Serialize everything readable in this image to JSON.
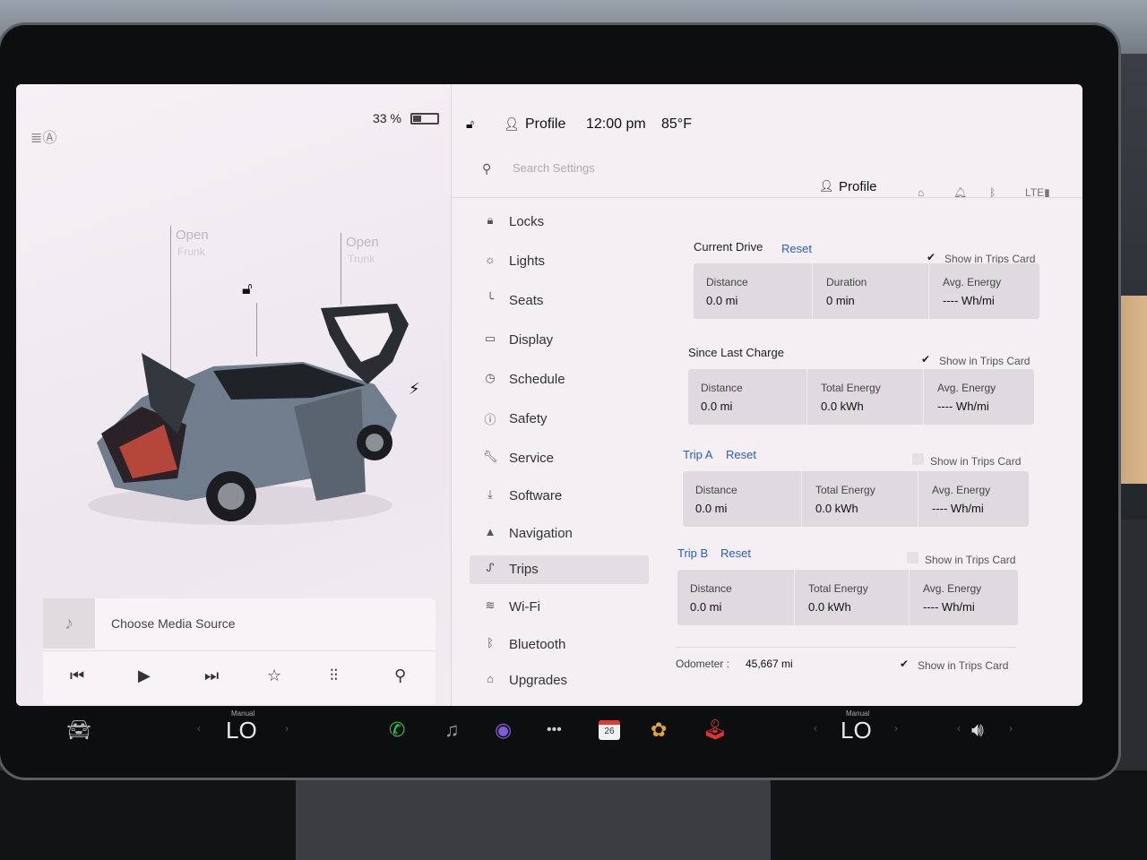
{
  "status": {
    "battery_percent": "33 %",
    "battery_level": 0.33,
    "profile": "Profile",
    "time": "12:00 pm",
    "temperature": "85°F"
  },
  "car": {
    "front_label": "Open",
    "front_sub": "Frunk",
    "rear_label": "Open",
    "rear_sub": "Trunk"
  },
  "media": {
    "source_label": "Choose Media Source"
  },
  "settings": {
    "search_placeholder": "Search Settings",
    "profile_label": "Profile",
    "menu": [
      {
        "label": "Locks",
        "icon": "lock-icon"
      },
      {
        "label": "Lights",
        "icon": "lights-icon"
      },
      {
        "label": "Seats",
        "icon": "seat-icon"
      },
      {
        "label": "Display",
        "icon": "display-icon"
      },
      {
        "label": "Schedule",
        "icon": "clock-icon"
      },
      {
        "label": "Safety",
        "icon": "safety-icon"
      },
      {
        "label": "Service",
        "icon": "wrench-icon"
      },
      {
        "label": "Software",
        "icon": "download-icon"
      },
      {
        "label": "Navigation",
        "icon": "navigation-icon"
      },
      {
        "label": "Trips",
        "icon": "trips-icon"
      },
      {
        "label": "Wi-Fi",
        "icon": "wifi-icon"
      },
      {
        "label": "Bluetooth",
        "icon": "bluetooth-icon"
      },
      {
        "label": "Upgrades",
        "icon": "bag-icon"
      }
    ],
    "active_menu": "Trips"
  },
  "trips": {
    "show_label": "Show in Trips Card",
    "reset_label": "Reset",
    "current_drive": {
      "title": "Current Drive",
      "show_checked": true,
      "distance_label": "Distance",
      "distance": "0.0 mi",
      "duration_label": "Duration",
      "duration": "0 min",
      "energy_label": "Avg. Energy",
      "energy": "---- Wh/mi"
    },
    "since_last_charge": {
      "title": "Since Last Charge",
      "show_checked": true,
      "distance_label": "Distance",
      "distance": "0.0 mi",
      "total_label": "Total Energy",
      "total": "0.0 kWh",
      "energy_label": "Avg. Energy",
      "energy": "---- Wh/mi"
    },
    "trip_a": {
      "title": "Trip A",
      "show_checked": false,
      "distance_label": "Distance",
      "distance": "0.0 mi",
      "total_label": "Total Energy",
      "total": "0.0 kWh",
      "energy_label": "Avg. Energy",
      "energy": "---- Wh/mi"
    },
    "trip_b": {
      "title": "Trip B",
      "show_checked": false,
      "distance_label": "Distance",
      "distance": "0.0 mi",
      "total_label": "Total Energy",
      "total": "0.0 kWh",
      "energy_label": "Avg. Energy",
      "energy": "---- Wh/mi"
    },
    "odometer": {
      "label": "Odometer :",
      "value": "45,667 mi",
      "show_checked": true
    }
  },
  "taskbar": {
    "left_climate_mode": "Manual",
    "left_temp": "LO",
    "right_climate_mode": "Manual",
    "right_temp": "LO",
    "calendar_day": "26"
  }
}
